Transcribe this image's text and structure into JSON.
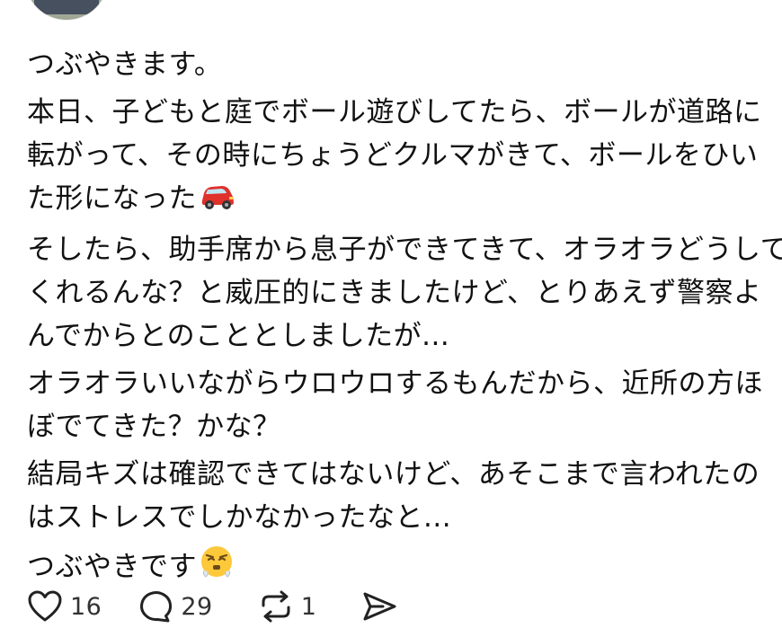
{
  "post": {
    "paragraphs": [
      {
        "lines": [
          "つぶやきます。"
        ]
      },
      {
        "lines": [
          "本日、子どもと庭でボール遊びしてたら、ボールが道路に",
          "転がって、その時にちょうどクルマがきて、ボールをひい",
          "た形になった"
        ],
        "trailing_emoji": "red-car-emoji"
      },
      {
        "lines": [
          "そしたら、助手席から息子ができてきて、オラオラどうして",
          "くれるんな？と威圧的にきましたけど、とりあえず警察よ",
          "んでからとのこととしましたが..."
        ]
      },
      {
        "lines": [
          "オラオラいいながらウロウロするもんだから、近所の方ほ",
          "ぼでてきた？かな？"
        ]
      },
      {
        "lines": [
          "結局キズは確認できてはないけど、あそこまで言われたの",
          "はストレスでしかなかったなと..."
        ]
      },
      {
        "lines": [
          "つぶやきです"
        ],
        "trailing_emoji": "steaming-face-emoji"
      }
    ]
  },
  "actions": {
    "like_count": "16",
    "reply_count": "29",
    "repost_count": "1"
  },
  "icons": {
    "like": "heart-icon",
    "reply": "speech-bubble-icon",
    "repost": "repost-icon",
    "share": "send-icon"
  },
  "colors": {
    "text": "#111111",
    "count": "#333333",
    "icon": "#222222"
  }
}
